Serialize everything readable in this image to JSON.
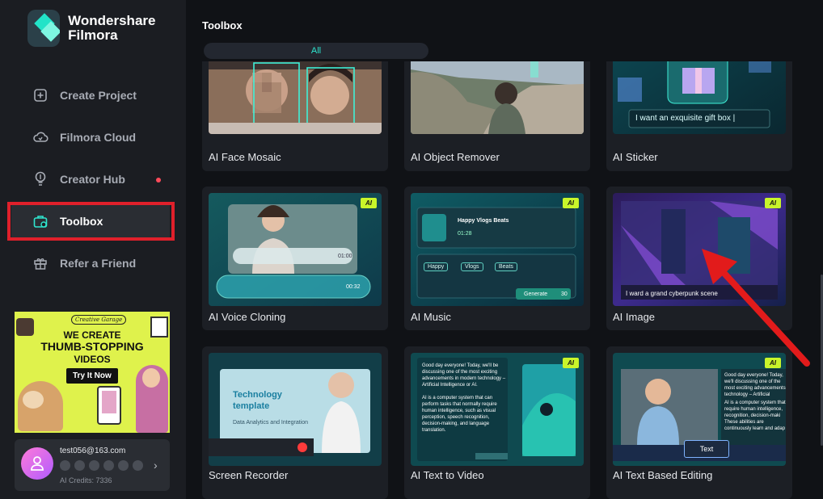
{
  "app": {
    "name": "Wondershare Filmora"
  },
  "sidebar": {
    "items": [
      {
        "label": "Create Project",
        "icon": "plus-square-icon"
      },
      {
        "label": "Filmora Cloud",
        "icon": "cloud-icon"
      },
      {
        "label": "Creator Hub",
        "icon": "bulb-icon"
      },
      {
        "label": "Toolbox",
        "icon": "toolbox-icon"
      },
      {
        "label": "Refer a Friend",
        "icon": "gift-icon"
      }
    ],
    "promo": {
      "brand": "Creative Garage",
      "line1": "WE CREATE",
      "line2": "THUMB-STOPPING",
      "line3": "VIDEOS",
      "button": "Try It Now"
    },
    "account": {
      "email": "test056@163.com",
      "credits": "AI Credits: 7336"
    }
  },
  "main": {
    "title": "Toolbox",
    "tab": "All",
    "cards": [
      {
        "name": "AI Face Mosaic"
      },
      {
        "name": "AI Object Remover"
      },
      {
        "name": "AI Sticker",
        "prompt": "I want an exquisite gift box |"
      },
      {
        "name": "AI Voice Cloning",
        "ai": "AI",
        "time1": "01:00",
        "time2": "00:32"
      },
      {
        "name": "AI Music",
        "ai": "AI",
        "track": "Happy Vlogs Beats",
        "time": "01:28",
        "chips": [
          "Happy",
          "Vlogs",
          "Beats"
        ],
        "generate": "Generate",
        "count": "30"
      },
      {
        "name": "AI Image",
        "ai": "AI",
        "prompt": "I ward a grand cyberpunk scene"
      },
      {
        "name": "Screen Recorder",
        "heading1": "Technology",
        "heading2": "template",
        "sub": "Data Analytics and Integration"
      },
      {
        "name": "AI Text to Video",
        "ai": "AI",
        "para1": "Good day everyone! Today, we'll be discussing one of the most exciting advancements in modern technology – Artificial Intelligence or AI.",
        "para2": "AI is a computer system that can perform tasks that normally require human intelligence, such as visual perception, speech recognition, decision-making, and language translation."
      },
      {
        "name": "AI Text Based Editing",
        "ai": "AI",
        "para1": "Good day everyone! Today, we'll discussing one of the most exciting advancements technology – Artificial Intelligence or AI.",
        "para2": "AI is a computer system that require human intelligence, recognition, decision-maki These abilities are continuously learn and adap",
        "chip": "Text"
      }
    ]
  },
  "colors": {
    "accent": "#2fe6cf",
    "highlight": "#e0202b",
    "ai_badge": "#c9f52a"
  }
}
